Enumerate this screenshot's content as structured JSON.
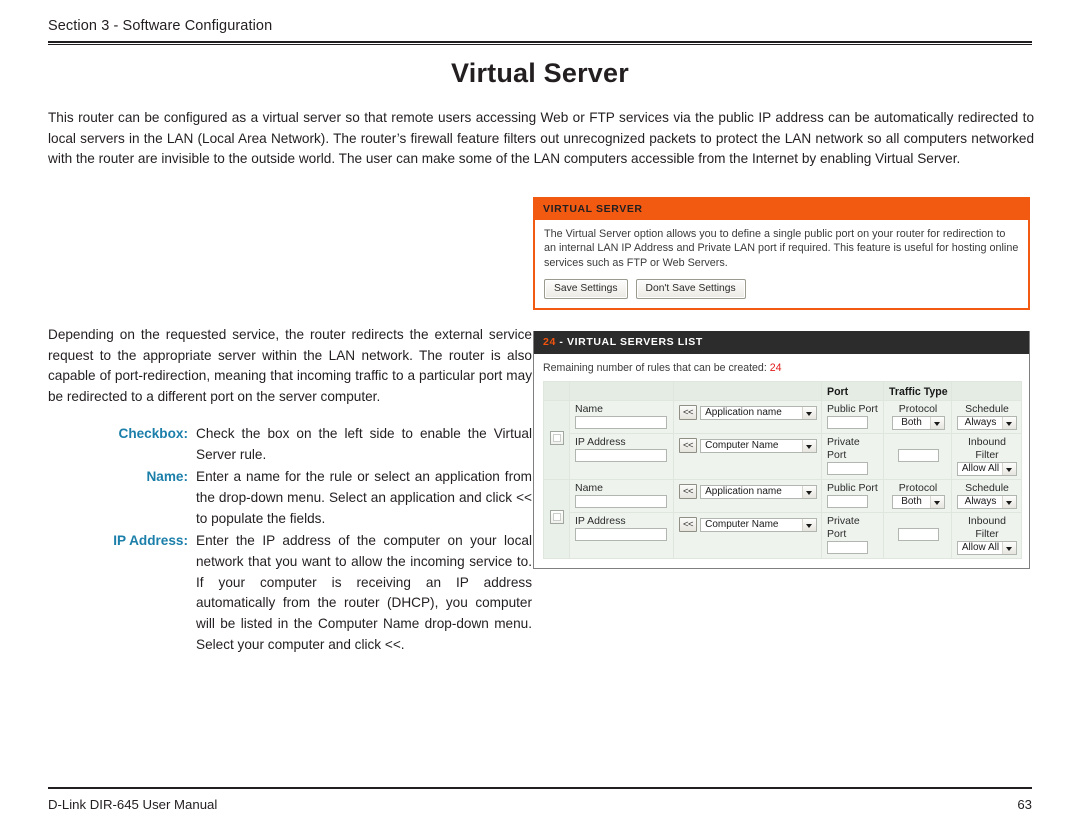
{
  "header": {
    "section_label": "Section 3 - Software Configuration"
  },
  "title": "Virtual Server",
  "intro": "This router can be configured as a virtual server so that remote users accessing Web or FTP services via the public IP address can be automatically redirected to local servers in the LAN (Local Area Network). The router’s firewall feature filters out unrecognized packets to protect the LAN network so all computers networked with the router are invisible to the outside world. The user can make some of the LAN computers accessible from the Internet by enabling Virtual Server.",
  "left_column": {
    "paragraph": "Depending on the requested service, the router redirects the external service request to the appropriate server within the LAN network. The router is also capable of port-redirection, meaning that incoming traffic to a particular port may be redirected to a different port on the server computer.",
    "definitions": [
      {
        "term": "Checkbox:",
        "description": "Check the box on the left side to enable the Virtual Server rule."
      },
      {
        "term": "Name:",
        "description": "Enter a name for the rule or select an application from the drop-down menu. Select an application and click << to populate the fields."
      },
      {
        "term": "IP Address:",
        "description": "Enter the IP address of the computer on your local network that you want to allow the incoming service to. If your computer is receiving an IP address automatically from the router (DHCP), you computer will be listed in the Computer Name drop-down menu. Select your computer and click <<."
      }
    ],
    "label_color": "#1b7faa"
  },
  "virtual_server_panel": {
    "header": "VIRTUAL SERVER",
    "description": "The Virtual Server option allows you to define a single public port on your router for redirection to an internal LAN IP Address and Private LAN port if required. This feature is useful for hosting online services such as FTP or Web Servers.",
    "save_button": "Save Settings",
    "dont_save_button": "Don't Save Settings",
    "accent_color": "#f25a12"
  },
  "servers_list_panel": {
    "header_number": "24",
    "header_rest": " - VIRTUAL SERVERS LIST",
    "remaining_label": "Remaining number of rules that can be created:",
    "remaining_count": "24",
    "column_headers": {
      "port": "Port",
      "traffic_type": "Traffic Type"
    },
    "rows": [
      {
        "name_label": "Name",
        "name_value": "",
        "app_arrow": "<<",
        "app_select": "Application name",
        "public_port_label": "Public Port",
        "public_port_value": "",
        "protocol_label": "Protocol",
        "protocol_select": "Both",
        "schedule_label": "Schedule",
        "schedule_select": "Always",
        "ip_label": "IP Address",
        "ip_value": "",
        "computer_arrow": "<<",
        "computer_select": "Computer Name",
        "private_port_label": "Private Port",
        "private_port_value": "",
        "protocol_num_value": "",
        "inbound_label": "Inbound Filter",
        "inbound_select": "Allow All"
      },
      {
        "name_label": "Name",
        "name_value": "",
        "app_arrow": "<<",
        "app_select": "Application name",
        "public_port_label": "Public Port",
        "public_port_value": "",
        "protocol_label": "Protocol",
        "protocol_select": "Both",
        "schedule_label": "Schedule",
        "schedule_select": "Always",
        "ip_label": "IP Address",
        "ip_value": "",
        "computer_arrow": "<<",
        "computer_select": "Computer Name",
        "private_port_label": "Private Port",
        "private_port_value": "",
        "protocol_num_value": "",
        "inbound_label": "Inbound Filter",
        "inbound_select": "Allow All"
      }
    ]
  },
  "footer": {
    "manual": "D-Link DIR-645 User Manual",
    "page_number": "63"
  }
}
